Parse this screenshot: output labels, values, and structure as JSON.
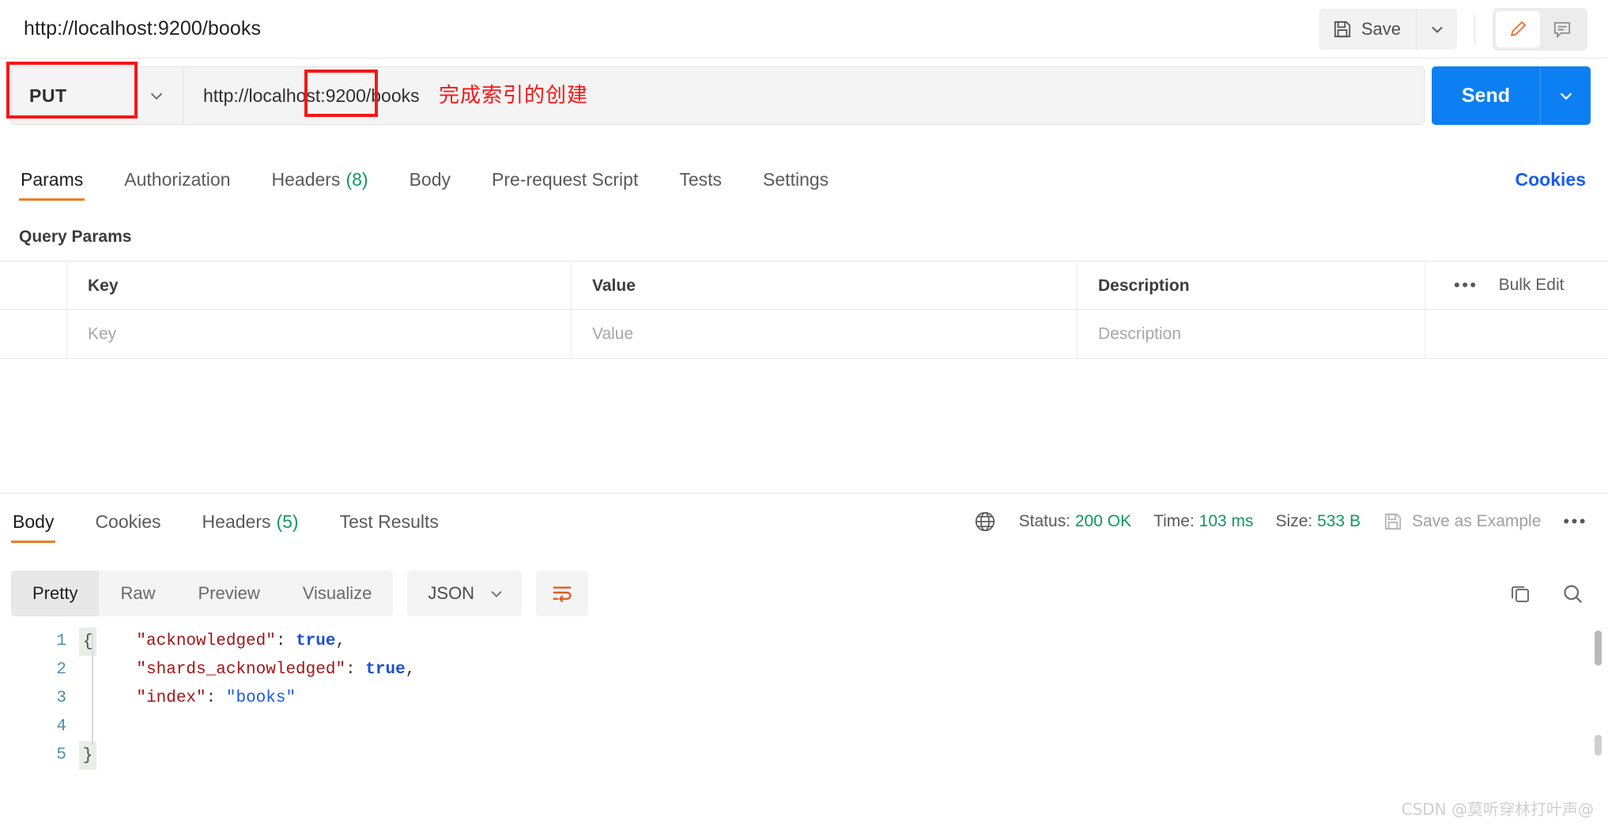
{
  "window": {
    "request_title": "http://localhost:9200/books"
  },
  "toolbar": {
    "save_label": "Save",
    "save_icon": "floppy-disk-icon",
    "save_caret_icon": "chevron-down-icon",
    "edit_icon": "pencil-icon",
    "comment_icon": "comment-icon"
  },
  "request": {
    "method": "PUT",
    "method_caret_icon": "chevron-down-icon",
    "url": "http://localhost:9200/books",
    "send_label": "Send",
    "send_caret_icon": "chevron-down-icon"
  },
  "annotations": {
    "note_text": "完成索引的创建",
    "box_color": "#f61616"
  },
  "request_tabs": [
    {
      "label": "Params",
      "count": "",
      "active": true
    },
    {
      "label": "Authorization",
      "count": "",
      "active": false
    },
    {
      "label": "Headers",
      "count": "(8)",
      "active": false
    },
    {
      "label": "Body",
      "count": "",
      "active": false
    },
    {
      "label": "Pre-request Script",
      "count": "",
      "active": false
    },
    {
      "label": "Tests",
      "count": "",
      "active": false
    },
    {
      "label": "Settings",
      "count": "",
      "active": false
    }
  ],
  "cookies_link": "Cookies",
  "query_params": {
    "section_title": "Query Params",
    "columns": [
      "Key",
      "Value",
      "Description"
    ],
    "rows": [
      {
        "key": "Key",
        "value": "Value",
        "description": "Description"
      }
    ],
    "more_icon": "ellipsis-icon",
    "bulk_edit_label": "Bulk Edit"
  },
  "response_tabs": [
    {
      "label": "Body",
      "count": "",
      "active": true
    },
    {
      "label": "Cookies",
      "count": "",
      "active": false
    },
    {
      "label": "Headers",
      "count": "(5)",
      "active": false
    },
    {
      "label": "Test Results",
      "count": "",
      "active": false
    }
  ],
  "response_meta": {
    "globe_icon": "globe-icon",
    "status_label": "Status:",
    "status_value": "200 OK",
    "time_label": "Time:",
    "time_value": "103 ms",
    "size_label": "Size:",
    "size_value": "533 B",
    "save_example_label": "Save as Example",
    "save_example_icon": "floppy-disk-icon",
    "more_icon": "ellipsis-icon",
    "status_color": "#0f9960"
  },
  "body_toolbar": {
    "views": [
      {
        "label": "Pretty",
        "active": true
      },
      {
        "label": "Raw",
        "active": false
      },
      {
        "label": "Preview",
        "active": false
      },
      {
        "label": "Visualize",
        "active": false
      }
    ],
    "format": "JSON",
    "format_caret_icon": "chevron-down-icon",
    "wrap_icon": "word-wrap-icon",
    "copy_icon": "copy-icon",
    "search_icon": "search-icon"
  },
  "response_body": {
    "line_numbers": [
      "1",
      "2",
      "3",
      "4",
      "5"
    ],
    "lines": [
      [
        {
          "t": "{",
          "c": "p"
        }
      ],
      [
        {
          "t": "    ",
          "c": "p"
        },
        {
          "t": "\"acknowledged\"",
          "c": "k"
        },
        {
          "t": ": ",
          "c": "p"
        },
        {
          "t": "true",
          "c": "b"
        },
        {
          "t": ",",
          "c": "p"
        }
      ],
      [
        {
          "t": "    ",
          "c": "p"
        },
        {
          "t": "\"shards_acknowledged\"",
          "c": "k"
        },
        {
          "t": ": ",
          "c": "p"
        },
        {
          "t": "true",
          "c": "b"
        },
        {
          "t": ",",
          "c": "p"
        }
      ],
      [
        {
          "t": "    ",
          "c": "p"
        },
        {
          "t": "\"index\"",
          "c": "k"
        },
        {
          "t": ": ",
          "c": "p"
        },
        {
          "t": "\"books\"",
          "c": "s"
        }
      ],
      [
        {
          "t": "}",
          "c": "p"
        }
      ]
    ]
  },
  "watermark": "CSDN @莫听穿林打叶声@"
}
